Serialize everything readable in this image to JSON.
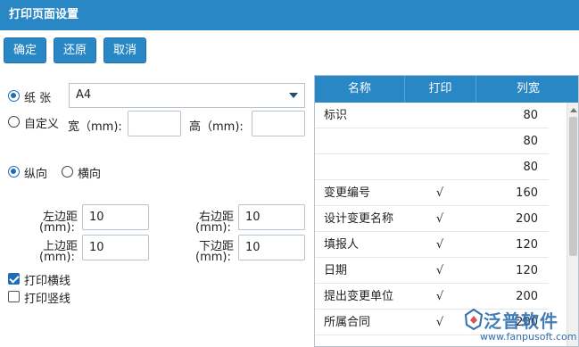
{
  "window": {
    "title": "打印页面设置"
  },
  "toolbar": {
    "ok_label": "确定",
    "reset_label": "还原",
    "cancel_label": "取消"
  },
  "paper": {
    "paper_label": "纸 张",
    "paper_value": "A4",
    "custom_label": "自定义",
    "width_label": "宽（mm):",
    "height_label": "高（mm):",
    "width_value": "",
    "height_value": ""
  },
  "orientation": {
    "portrait_label": "纵向",
    "landscape_label": "横向",
    "selected": "portrait"
  },
  "margins": {
    "left_label_1": "左边距",
    "left_label_2": "(mm):",
    "left_value": "10",
    "right_label_1": "右边距",
    "right_label_2": "(mm):",
    "right_value": "10",
    "top_label_1": "上边距",
    "top_label_2": "(mm):",
    "top_value": "10",
    "bottom_label_1": "下边距",
    "bottom_label_2": "(mm):",
    "bottom_value": "10"
  },
  "options": {
    "print_hlines_label": "打印横线",
    "print_hlines_checked": true,
    "print_vlines_label": "打印竖线",
    "print_vlines_checked": false
  },
  "columns_table": {
    "headers": [
      "名称",
      "打印",
      "列宽"
    ],
    "rows": [
      {
        "name": "标识",
        "print": "",
        "width": "80"
      },
      {
        "name": "",
        "print": "",
        "width": "80"
      },
      {
        "name": "",
        "print": "",
        "width": "80"
      },
      {
        "name": "变更编号",
        "print": "√",
        "width": "160"
      },
      {
        "name": "设计变更名称",
        "print": "√",
        "width": "200"
      },
      {
        "name": "填报人",
        "print": "√",
        "width": "120"
      },
      {
        "name": "日期",
        "print": "√",
        "width": "120"
      },
      {
        "name": "提出变更单位",
        "print": "√",
        "width": "200"
      },
      {
        "name": "所属合同",
        "print": "√",
        "width": "200"
      }
    ]
  },
  "watermark": {
    "brand": "泛普软件",
    "url": "www.fanpusoft.com"
  },
  "colors": {
    "accent": "#2a87c6",
    "radio": "#1e6db5"
  }
}
